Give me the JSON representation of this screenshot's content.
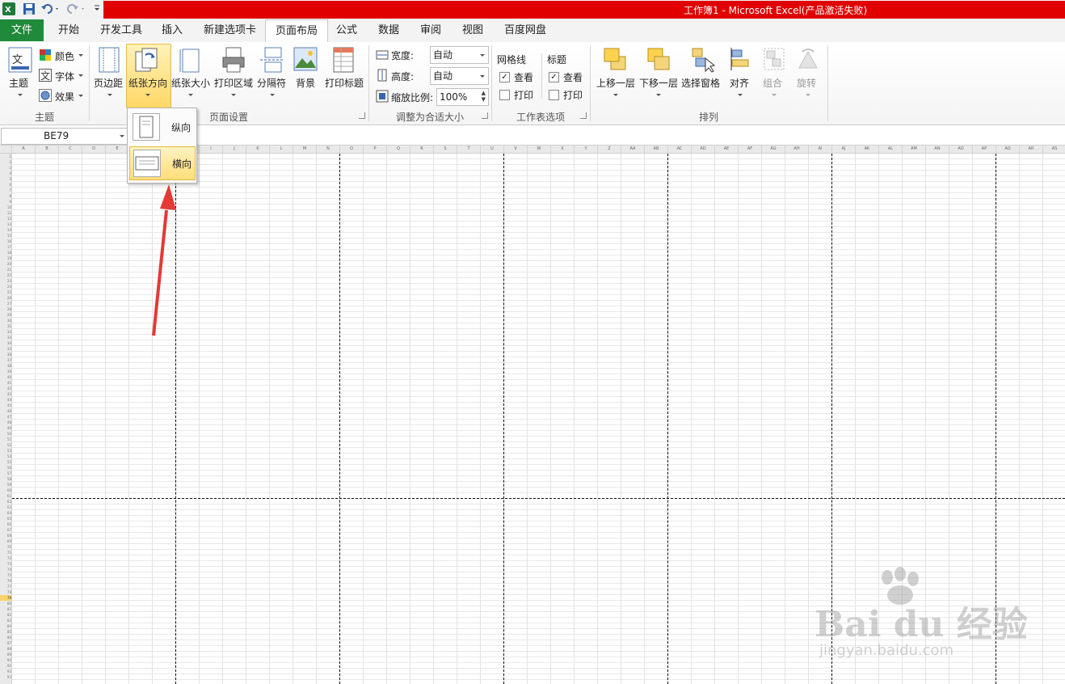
{
  "window": {
    "title": "工作簿1 - Microsoft Excel(产品激活失败)"
  },
  "tabs": [
    "文件",
    "开始",
    "开发工具",
    "插入",
    "新建选项卡",
    "页面布局",
    "公式",
    "数据",
    "审阅",
    "视图",
    "百度网盘"
  ],
  "ribbon": {
    "theme_group": {
      "label": "主题",
      "theme_btn": "主题",
      "colors": "颜色",
      "fonts": "字体",
      "effects": "效果"
    },
    "page_setup": {
      "label": "页面设置",
      "margins": "页边距",
      "orientation": "纸张方向",
      "size": "纸张大小",
      "print_area": "打印区域",
      "breaks": "分隔符",
      "background": "背景",
      "print_titles": "打印标题"
    },
    "scale": {
      "label": "调整为合适大小",
      "width_label": "宽度:",
      "width_value": "自动",
      "height_label": "高度:",
      "height_value": "自动",
      "scale_label": "缩放比例:",
      "scale_value": "100%"
    },
    "sheet_options": {
      "label": "工作表选项",
      "gridlines": "网格线",
      "headings": "标题",
      "view": "查看",
      "print": "打印",
      "grid_view_checked": true,
      "grid_print_checked": false,
      "head_view_checked": true,
      "head_print_checked": false
    },
    "arrange": {
      "label": "排列",
      "bring_forward": "上移一层",
      "send_backward": "下移一层",
      "selection_pane": "选择窗格",
      "align": "对齐",
      "group": "组合",
      "rotate": "旋转"
    }
  },
  "formula_bar": {
    "name_box": "BE79"
  },
  "orientation_menu": {
    "items": [
      "纵向",
      "横向"
    ],
    "hovered": "横向"
  },
  "columns": [
    "A",
    "B",
    "C",
    "D",
    "E",
    "F",
    "G",
    "H",
    "I",
    "J",
    "K",
    "L",
    "M",
    "N",
    "O",
    "P",
    "Q",
    "R",
    "S",
    "T",
    "U",
    "V",
    "W",
    "X",
    "Y",
    "Z",
    "AA",
    "AB",
    "AC",
    "AD",
    "AE",
    "AF",
    "AG",
    "AH",
    "AI",
    "AJ",
    "AK",
    "AL",
    "AM",
    "AN",
    "AO",
    "AP",
    "AQ",
    "AR",
    "AS"
  ],
  "watermark": {
    "brand": "Bai  du 经验",
    "url": "jingyan.baidu.com"
  },
  "colors": {
    "file_tab": "#1e8a3a",
    "title_red": "#e00000",
    "highlight": "#ffd766",
    "arrow": "#e53935"
  }
}
